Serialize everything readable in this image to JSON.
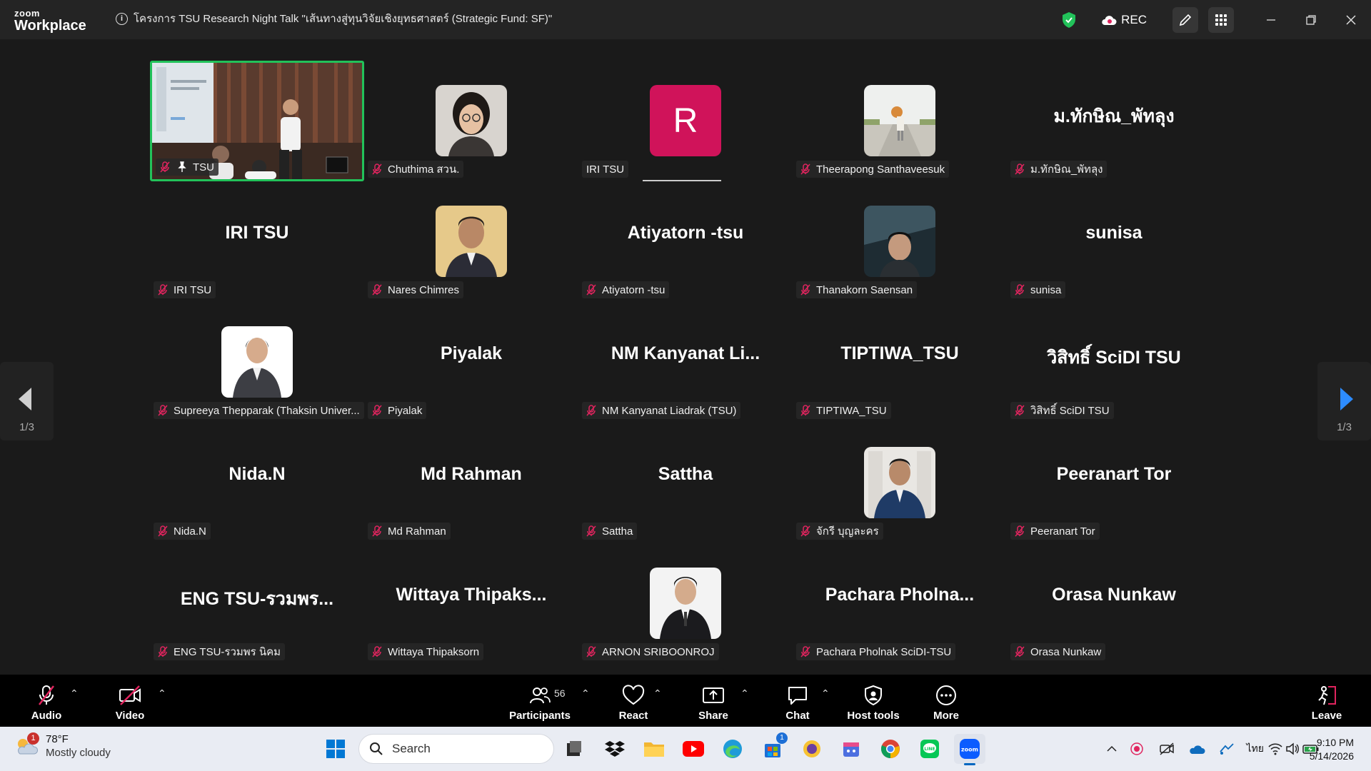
{
  "app": {
    "logo_line1": "zoom",
    "logo_line2": "Workplace",
    "meeting_title": "โครงการ TSU Research Night Talk \"เส้นทางสู่ทุนวิจัยเชิงยุทธศาสตร์ (Strategic Fund: SF)\"",
    "rec_label": "REC"
  },
  "colors": {
    "active_speaker": "#22c25a",
    "avatar_r": "#d0135a",
    "mic_muted": "#e0245e",
    "nav_arrow": "#2d8cff"
  },
  "gallery": {
    "page_indicator_left": "1/3",
    "page_indicator_right": "1/3",
    "tiles": [
      {
        "label": "TSU",
        "type": "video",
        "active_speaker": true,
        "pinned": true
      },
      {
        "label": "Chuthima สวน.",
        "type": "photo"
      },
      {
        "label": "IRI TSU",
        "type": "initial",
        "initial": "R"
      },
      {
        "label": "Theerapong Santhaveesuk",
        "type": "photo"
      },
      {
        "label": "ม.ทักษิณ_พัทลุง",
        "type": "name",
        "big_name": "ม.ทักษิณ_พัทลุง"
      },
      {
        "label": "IRI TSU",
        "type": "name",
        "big_name": "IRI TSU"
      },
      {
        "label": "Nares Chimres",
        "type": "photo"
      },
      {
        "label": "Atiyatorn -tsu",
        "type": "name",
        "big_name": "Atiyatorn -tsu"
      },
      {
        "label": "Thanakorn Saensan",
        "type": "photo"
      },
      {
        "label": "sunisa",
        "type": "name",
        "big_name": "sunisa"
      },
      {
        "label": "Supreeya Thepparak (Thaksin Univer...",
        "type": "photo"
      },
      {
        "label": "Piyalak",
        "type": "name",
        "big_name": "Piyalak"
      },
      {
        "label": "NM Kanyanat Liadrak (TSU)",
        "type": "name",
        "big_name": "NM Kanyanat Li..."
      },
      {
        "label": "TIPTIWA_TSU",
        "type": "name",
        "big_name": "TIPTIWA_TSU"
      },
      {
        "label": "วิสิทธิ์ SciDI TSU",
        "type": "name",
        "big_name": "วิสิทธิ์ SciDI TSU"
      },
      {
        "label": "Nida.N",
        "type": "name",
        "big_name": "Nida.N"
      },
      {
        "label": "Md Rahman",
        "type": "name",
        "big_name": "Md Rahman"
      },
      {
        "label": "Sattha",
        "type": "name",
        "big_name": "Sattha"
      },
      {
        "label": "จักรี บุญละคร",
        "type": "photo"
      },
      {
        "label": "Peeranart Tor",
        "type": "name",
        "big_name": "Peeranart Tor"
      },
      {
        "label": "ENG TSU-รวมพร นิคม",
        "type": "name",
        "big_name": "ENG TSU-รวมพร..."
      },
      {
        "label": "Wittaya Thipaksorn",
        "type": "name",
        "big_name": "Wittaya Thipaks..."
      },
      {
        "label": "ARNON SRIBOONROJ",
        "type": "photo"
      },
      {
        "label": "Pachara Pholnak SciDI-TSU",
        "type": "name",
        "big_name": "Pachara Pholna..."
      },
      {
        "label": "Orasa Nunkaw",
        "type": "name",
        "big_name": "Orasa Nunkaw"
      }
    ]
  },
  "toolbar": {
    "audio": "Audio",
    "video": "Video",
    "participants": "Participants",
    "participants_count": "56",
    "react": "React",
    "share": "Share",
    "chat": "Chat",
    "host_tools": "Host tools",
    "more": "More",
    "leave": "Leave"
  },
  "taskbar": {
    "weather_badge": "1",
    "temperature": "78°F",
    "weather_desc": "Mostly cloudy",
    "search_placeholder": "Search",
    "chrome_badge": "1",
    "language": "ไทย",
    "time": "9:10 PM",
    "date": "5/14/2026"
  }
}
